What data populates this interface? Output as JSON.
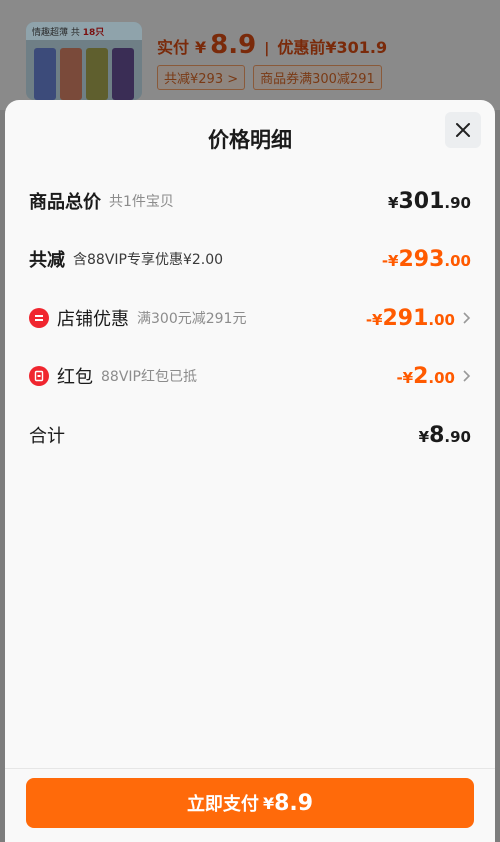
{
  "background": {
    "thumbnail": {
      "title": "情趣超薄",
      "qty_label": "共",
      "qty_value": "18只"
    },
    "pay_label": "实付",
    "yen": "¥",
    "pay_amount": "8.9",
    "separator": "|",
    "before_label": "优惠前¥301.9",
    "chips": [
      "共减¥293 >",
      "商品券满300减291"
    ]
  },
  "sheet": {
    "title": "价格明细",
    "rows": [
      {
        "label": "商品总价",
        "note": "共1件宝贝",
        "yen": "¥",
        "int": "301",
        "dec": ".90"
      },
      {
        "label": "共减",
        "note": "含88VIP专享优惠¥2.00",
        "yen": "-¥",
        "int": "293",
        "dec": ".00"
      },
      {
        "label": "店铺优惠",
        "note": "满300元减291元",
        "yen": "-¥",
        "int": "291",
        "dec": ".00",
        "icon": "store-icon"
      },
      {
        "label": "红包",
        "note": "88VIP红包已抵",
        "yen": "-¥",
        "int": "2",
        "dec": ".00",
        "icon": "red-packet-icon"
      },
      {
        "label": "合计",
        "yen": "¥",
        "int": "8",
        "dec": ".90"
      }
    ]
  },
  "pay_button": {
    "label": "立即支付",
    "yen": "¥",
    "amount": "8.9"
  },
  "colors": {
    "accent": "#ff6a0a",
    "discount": "#ff5a00",
    "badge": "#f0262f"
  }
}
